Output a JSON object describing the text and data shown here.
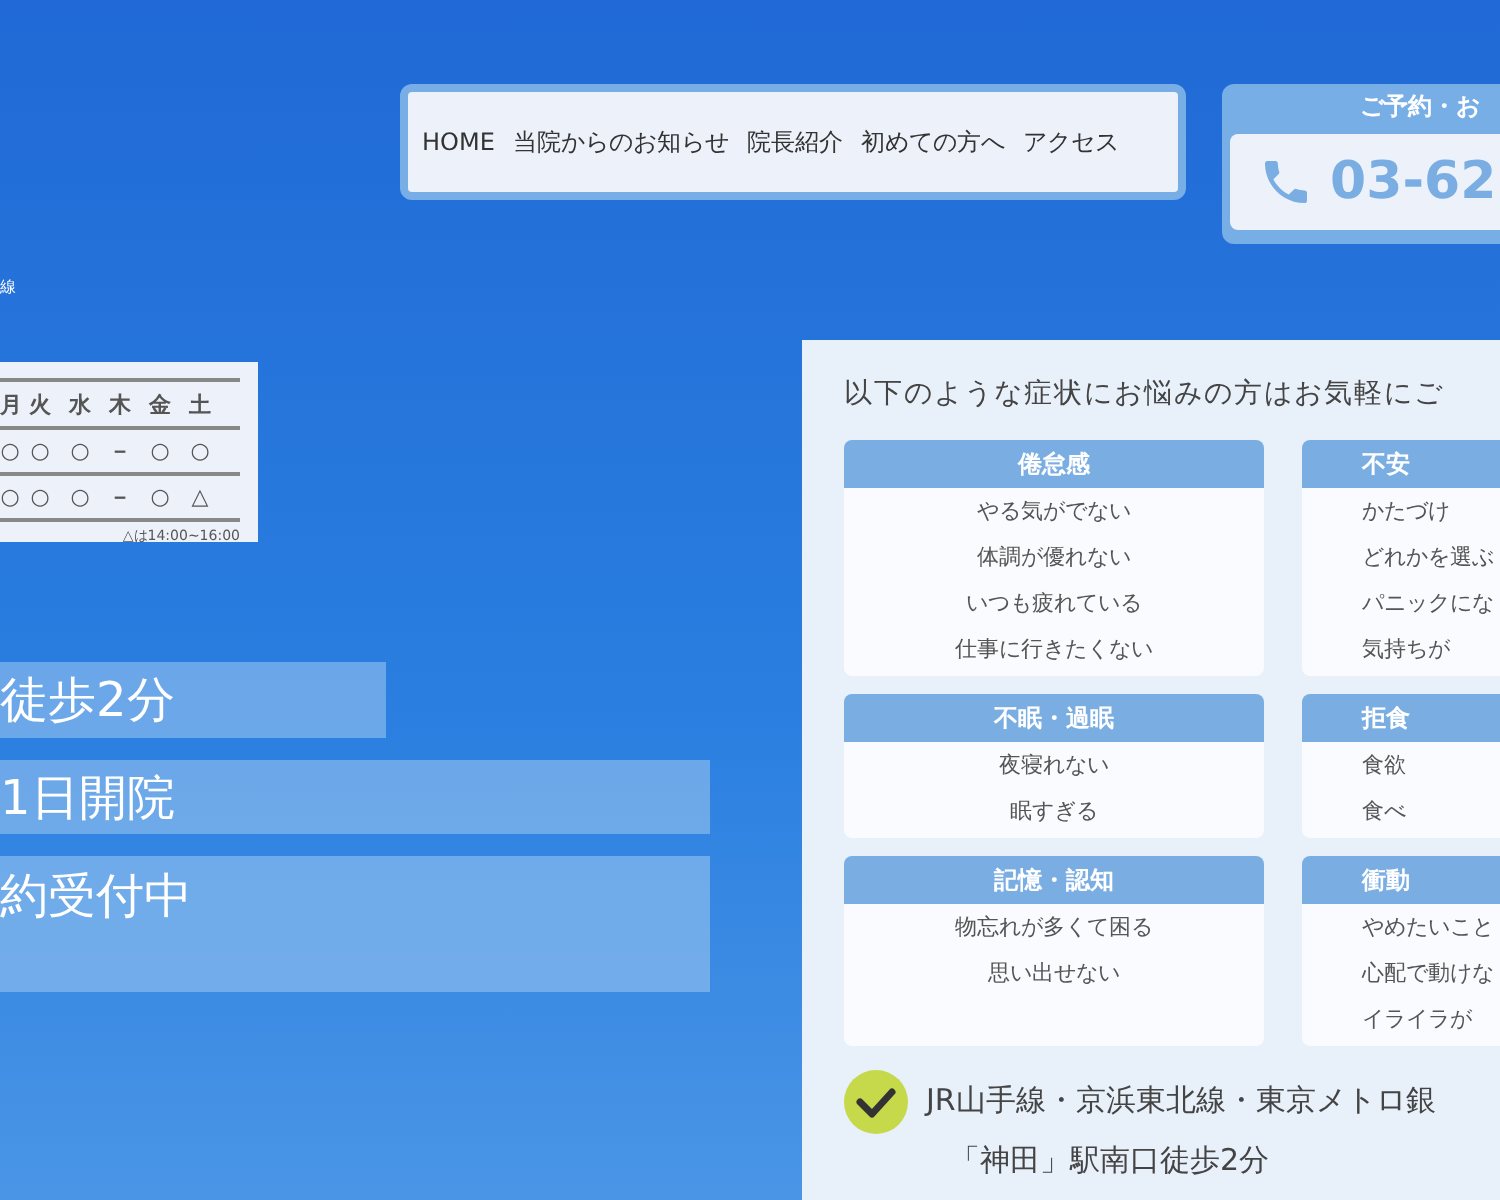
{
  "nav": {
    "items": [
      "HOME",
      "当院からのお知らせ",
      "院長紹介",
      "初めての方へ",
      "アクセス"
    ]
  },
  "contact": {
    "label": "ご予約・お",
    "phone": "03-62"
  },
  "line_fragment": "線",
  "schedule": {
    "days": [
      "月",
      "火",
      "水",
      "木",
      "金",
      "土"
    ],
    "rows": [
      [
        "○",
        "○",
        "○",
        "－",
        "○",
        "○"
      ],
      [
        "○",
        "○",
        "○",
        "－",
        "○",
        "△"
      ]
    ],
    "note": "△は14:00~16:00"
  },
  "banners": [
    {
      "lines": [
        "徒歩2分"
      ]
    },
    {
      "lines": [
        "1日開院"
      ]
    },
    {
      "lines": [
        "約受付中"
      ]
    }
  ],
  "symptoms": {
    "heading": "以下のような症状にお悩みの方はお気軽にご",
    "cards": [
      {
        "title": "倦怠感",
        "items": [
          "やる気がでない",
          "体調が優れない",
          "いつも疲れている",
          "仕事に行きたくない"
        ]
      },
      {
        "title": "不安",
        "items": [
          "かたづけ",
          "どれかを選ぶ",
          "パニックにな",
          "気持ちが"
        ]
      },
      {
        "title": "不眠・過眠",
        "items": [
          "夜寝れない",
          "眠すぎる"
        ]
      },
      {
        "title": "拒食",
        "items": [
          "食欲",
          "食べ"
        ]
      },
      {
        "title": "記憶・認知",
        "items": [
          "物忘れが多くて困る",
          "思い出せない"
        ]
      },
      {
        "title": "衝動",
        "items": [
          "やめたいこと",
          "心配で動けな",
          "イライラが"
        ]
      }
    ]
  },
  "access": {
    "lines": [
      "JR山手線・京浜東北線・東京メトロ銀",
      "「神田」駅南口徒歩2分"
    ]
  }
}
